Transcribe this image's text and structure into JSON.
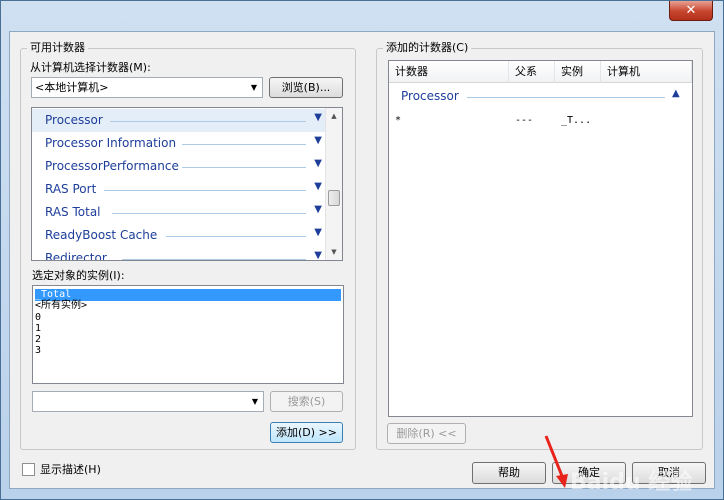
{
  "window": {
    "close_glyph": "✕"
  },
  "available": {
    "group_title": "可用计数器",
    "select_from_label": "从计算机选择计数器(M):",
    "computer_value": "<本地计算机>",
    "browse_label": "浏览(B)...",
    "counters": [
      {
        "name": "Processor",
        "selected": true
      },
      {
        "name": "Processor Information",
        "selected": false
      },
      {
        "name": "ProcessorPerformance",
        "selected": false
      },
      {
        "name": "RAS Port",
        "selected": false
      },
      {
        "name": "RAS Total",
        "selected": false
      },
      {
        "name": "ReadyBoost Cache",
        "selected": false
      },
      {
        "name": "Redirector",
        "selected": false
      }
    ],
    "instances_label": "选定对象的实例(I):",
    "instances": [
      "_Total",
      "<所有实例>",
      "0",
      "1",
      "2",
      "3"
    ],
    "search_value": "",
    "search_label": "搜索(S)",
    "add_label": "添加(D) >>"
  },
  "added": {
    "group_title": "添加的计数器(C)",
    "columns": [
      "计数器",
      "父系",
      "实例",
      "计算机"
    ],
    "group_name": "Processor",
    "rows": [
      {
        "counter": "*",
        "parent": "---",
        "instance": "_T...",
        "computer": ""
      }
    ],
    "remove_label": "删除(R) <<"
  },
  "footer": {
    "show_desc_label": "显示描述(H)",
    "help_label": "帮助",
    "ok_label": "确定",
    "cancel_label": "取消"
  },
  "watermark": "Baidu 经验"
}
